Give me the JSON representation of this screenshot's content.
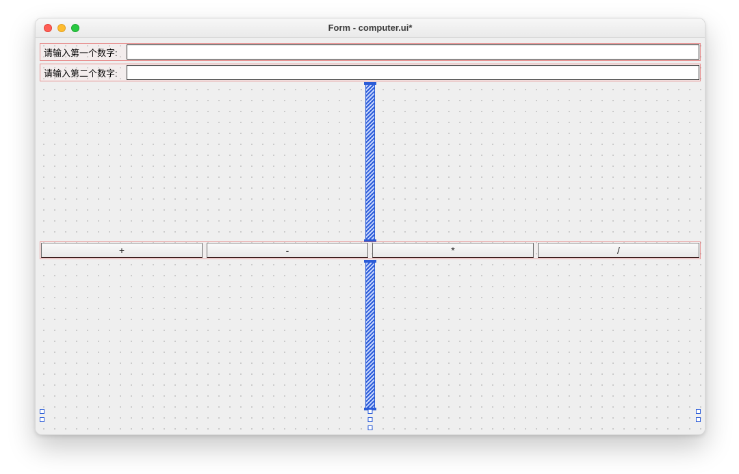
{
  "window": {
    "title": "Form - computer.ui*"
  },
  "fields": {
    "first": {
      "label": "请输入第一个数字:",
      "value": ""
    },
    "second": {
      "label": "请输入第二个数字:",
      "value": ""
    }
  },
  "operators": {
    "add": {
      "label": "+"
    },
    "subtract": {
      "label": "-"
    },
    "multiply": {
      "label": "*"
    },
    "divide": {
      "label": "/"
    }
  }
}
